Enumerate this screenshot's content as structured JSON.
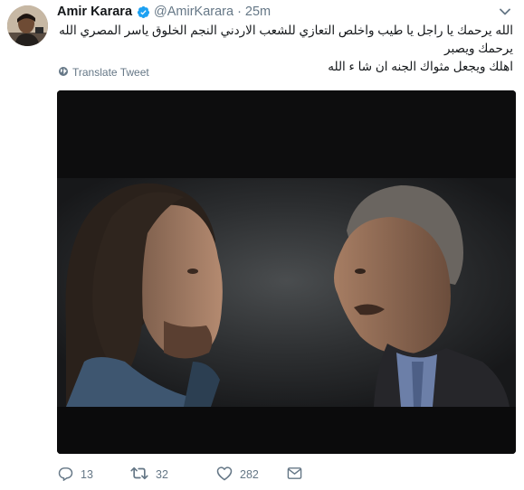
{
  "tweet": {
    "author": {
      "name": "Amir Karara",
      "handle": "@AmirKarara",
      "verified": true,
      "avatar_icon": "avatar"
    },
    "separator": "·",
    "time": "25m",
    "text_line1": "الله يرحمك يا راجل يا طيب واخلص التعازي للشعب الاردني النجم الخلوق ياسر المصري الله يرحمك ويصبر",
    "text_line2": "اهلك ويجعل مثواك الجنه ان شا ء الله",
    "translate_label": "Translate Tweet",
    "stats": {
      "replies": "13",
      "retweets": "32",
      "likes": "282"
    }
  },
  "icons": {
    "verified": "verified-badge-icon",
    "caret": "chevron-down-icon",
    "globe": "globe-icon",
    "reply": "reply-icon",
    "retweet": "retweet-icon",
    "like": "heart-icon",
    "dm": "envelope-icon"
  },
  "colors": {
    "verified": "#1da1f2",
    "secondary_text": "#657786",
    "primary_text": "#14171a",
    "media_background": "#0e0e0f"
  }
}
